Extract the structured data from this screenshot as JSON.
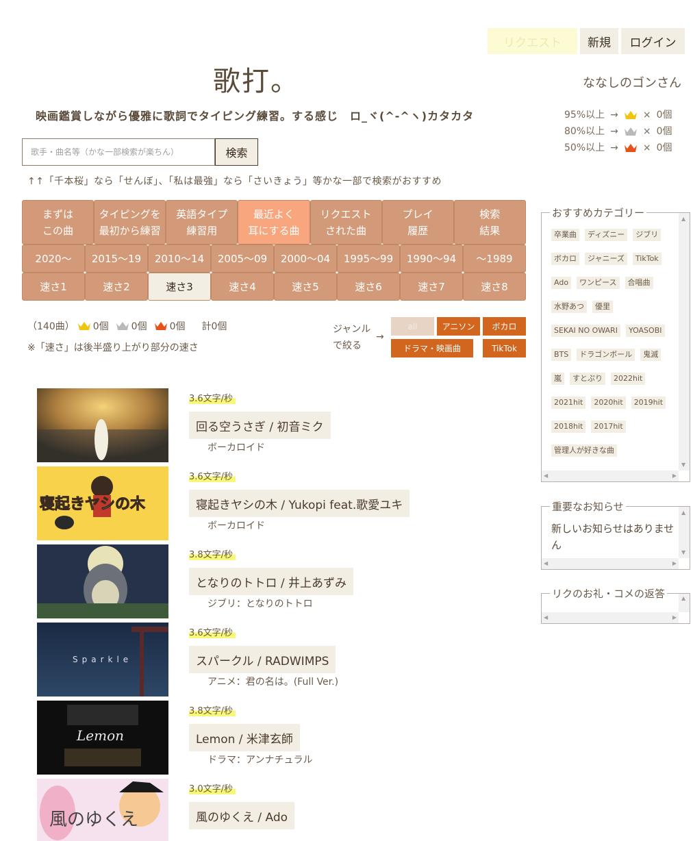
{
  "nav": {
    "request": "リクエスト",
    "new": "新規",
    "login": "ログイン"
  },
  "logo": "歌打。",
  "tagline": "映画鑑賞しながら優雅に歌詞でタイピング練習。する感じ　ロ_ヾ(^-^ヽ)カタカタ",
  "username": "ななしのゴンさん",
  "crown_stats": [
    {
      "label": "95%以上",
      "arrow": "→",
      "color": "#f1c40f",
      "times": "×",
      "count": "0個"
    },
    {
      "label": "80%以上",
      "arrow": "→",
      "color": "#b9b9b9",
      "times": "×",
      "count": "0個"
    },
    {
      "label": "50%以上",
      "arrow": "→",
      "color": "#e8521a",
      "times": "×",
      "count": "0個"
    }
  ],
  "search": {
    "placeholder": "歌手・曲名等（かな一部検索が楽ちん）",
    "button": "検索",
    "hint": "↑↑「千本桜」なら「せんぼ」、「私は最強」なら「さいきょう」等かな一部で検索がおすすめ"
  },
  "categories_row1": [
    {
      "l1": "まずは",
      "l2": "この曲"
    },
    {
      "l1": "タイピングを",
      "l2": "最初から練習"
    },
    {
      "l1": "英語タイプ",
      "l2": "練習用"
    },
    {
      "l1": "最近よく",
      "l2": "耳にする曲"
    },
    {
      "l1": "リクエスト",
      "l2": "された曲"
    },
    {
      "l1": "プレイ",
      "l2": "履歴"
    },
    {
      "l1": "検索",
      "l2": "結果"
    }
  ],
  "categories_row2": [
    "2020～",
    "2015～19",
    "2010～14",
    "2005～09",
    "2000～04",
    "1995～99",
    "1990～94",
    "～1989"
  ],
  "categories_row3": [
    "速さ1",
    "速さ2",
    "速さ3",
    "速さ4",
    "速さ5",
    "速さ6",
    "速さ7",
    "速さ8"
  ],
  "counts": {
    "songs": "（140曲）",
    "gold": "0個",
    "silver": "0個",
    "red": "0個",
    "total": "計0個"
  },
  "speed_note": "※「速さ」は後半盛り上がり部分の速さ",
  "genre": {
    "label1": "ジャンル",
    "label2": "で絞る",
    "arrow": "→",
    "all": "all",
    "anison": "アニソン",
    "vocaloid": "ボカロ",
    "drama": "ドラマ・映画曲",
    "tiktok": "TikTok"
  },
  "songs": [
    {
      "speed": "3.6文字/秒",
      "title": "回る空うさぎ / 初音ミク",
      "sub": "ボーカロイド"
    },
    {
      "speed": "3.6文字/秒",
      "title": "寝起きヤシの木 / Yukopi feat.歌愛ユキ",
      "sub": "ボーカロイド"
    },
    {
      "speed": "3.8文字/秒",
      "title": "となりのトトロ / 井上あずみ",
      "sub": "ジブリ：となりのトトロ"
    },
    {
      "speed": "3.6文字/秒",
      "title": "スパークル / RADWIMPS",
      "sub": "アニメ：君の名は。(Full Ver.)"
    },
    {
      "speed": "3.8文字/秒",
      "title": "Lemon / 米津玄師",
      "sub": "ドラマ：アンナチュラル"
    },
    {
      "speed": "3.0文字/秒",
      "title": "風のゆくえ / Ado",
      "sub": ""
    }
  ],
  "thumb_text": {
    "t2": "寝起きヤシの木",
    "t4": "Sparkle",
    "t5": "Lemon",
    "t6": "風のゆくえ"
  },
  "recommended": {
    "legend": "おすすめカテゴリー",
    "tags": [
      "卒業曲",
      "ディズニー",
      "ジブリ",
      "ボカロ",
      "ジャニーズ",
      "TikTok",
      "Ado",
      "ワンピース",
      "合唱曲",
      "水野あつ",
      "優里",
      "SEKAI NO OWARI",
      "YOASOBI",
      "BTS",
      "ドラゴンボール",
      "鬼滅",
      "嵐",
      "すとぷり",
      "2022hit",
      "2021hit",
      "2020hit",
      "2019hit",
      "2018hit",
      "2017hit",
      "管理人が好きな曲"
    ]
  },
  "notice": {
    "legend": "重要なお知らせ",
    "text": "新しいお知らせはありません"
  },
  "replies": {
    "legend": "リクのお礼・コメの返答"
  }
}
